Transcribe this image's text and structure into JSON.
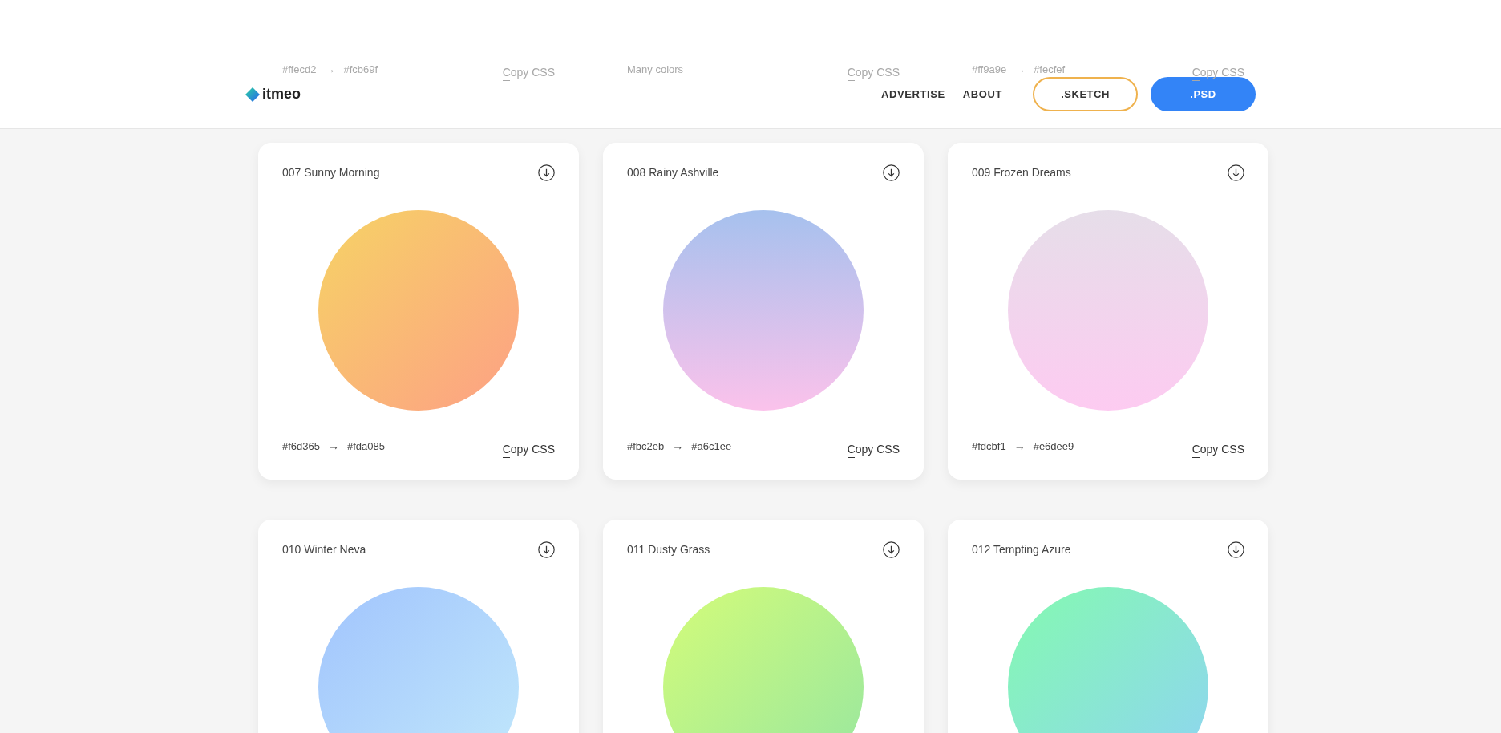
{
  "header": {
    "logo": "itmeo",
    "nav": [
      {
        "label": "ADVERTISE"
      },
      {
        "label": "ABOUT"
      }
    ],
    "buttons": [
      {
        "label": ".SKETCH",
        "kind": "outline"
      },
      {
        "label": ".PSD",
        "kind": "filled"
      }
    ]
  },
  "previous_row": [
    {
      "kind": "pair",
      "from": "#ffecd2",
      "arrow": "→",
      "to": "#fcb69f",
      "copy": "Copy CSS"
    },
    {
      "kind": "text",
      "note": "Many colors",
      "copy": "Copy CSS"
    },
    {
      "kind": "pair",
      "from": "#ff9a9e",
      "arrow": "→",
      "to": "#fecfef",
      "copy": "Copy CSS"
    }
  ],
  "cards": [
    {
      "title": "007 Sunny Morning",
      "kind": "diagonal",
      "stops": [
        {
          "color": "#f6d365"
        },
        {
          "color": "#fda085"
        }
      ],
      "from": "#f6d365",
      "arrow": "→",
      "to": "#fda085",
      "copy": "Copy CSS"
    },
    {
      "title": "008 Rainy Ashville",
      "kind": "vertical",
      "stops": [
        {
          "color": "#a6c1ee"
        },
        {
          "color": "#fbc2eb"
        }
      ],
      "from": "#fbc2eb",
      "arrow": "→",
      "to": "#a6c1ee",
      "copy": "Copy CSS"
    },
    {
      "title": "009 Frozen Dreams",
      "kind": "vertical",
      "stops": [
        {
          "color": "#e6dee9"
        },
        {
          "color": "#fdcbf1"
        }
      ],
      "from": "#fdcbf1",
      "arrow": "→",
      "to": "#e6dee9",
      "copy": "Copy CSS"
    },
    {
      "title": "010 Winter Neva",
      "kind": "diagonal",
      "stops": [
        {
          "color": "#a1c4fd"
        },
        {
          "color": "#c2e9fb"
        }
      ]
    },
    {
      "title": "011 Dusty Grass",
      "kind": "diagonal",
      "stops": [
        {
          "color": "#d4fc79"
        },
        {
          "color": "#96e6a1"
        }
      ]
    },
    {
      "title": "012 Tempting Azure",
      "kind": "diagonal",
      "stops": [
        {
          "color": "#84fab0"
        },
        {
          "color": "#8fd3f4"
        }
      ]
    }
  ]
}
